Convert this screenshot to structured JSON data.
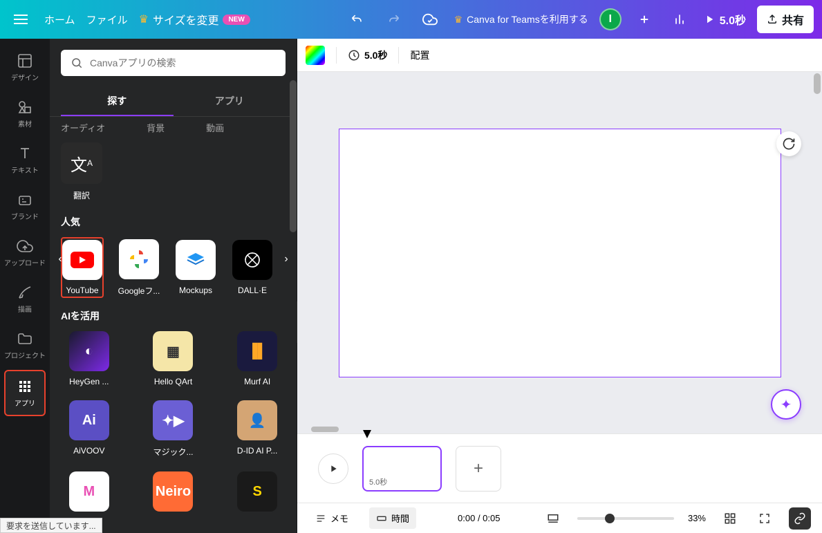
{
  "header": {
    "home": "ホーム",
    "file": "ファイル",
    "resize": "サイズを変更",
    "new_badge": "NEW",
    "teams": "Canva for Teamsを利用する",
    "avatar_initial": "I",
    "play_time": "5.0秒",
    "share": "共有"
  },
  "rail": {
    "design": "デザイン",
    "elements": "素材",
    "text": "テキスト",
    "brand": "ブランド",
    "upload": "アップロード",
    "draw": "描画",
    "projects": "プロジェクト",
    "apps": "アプリ"
  },
  "panel": {
    "search_placeholder": "Canvaアプリの検索",
    "tab_explore": "探す",
    "tab_apps": "アプリ",
    "sub_audio": "オーディオ",
    "sub_bg": "背景",
    "sub_video": "動画",
    "translate_label": "翻訳",
    "popular_title": "人気",
    "popular": [
      {
        "name": "YouTube"
      },
      {
        "name": "Googleフ..."
      },
      {
        "name": "Mockups"
      },
      {
        "name": "DALL·E"
      }
    ],
    "ai_title": "AIを活用",
    "ai_apps": [
      {
        "name": "HeyGen ..."
      },
      {
        "name": "Hello QArt"
      },
      {
        "name": "Murf AI"
      },
      {
        "name": "AiVOOV"
      },
      {
        "name": "マジック..."
      },
      {
        "name": "D-ID AI P..."
      }
    ]
  },
  "canvas_toolbar": {
    "duration": "5.0秒",
    "arrange": "配置"
  },
  "timeline": {
    "frame_label": "5.0秒"
  },
  "bottom": {
    "memo": "メモ",
    "time": "時間",
    "timecode": "0:00 / 0:05",
    "zoom": "33%"
  },
  "status": "要求を送信しています..."
}
